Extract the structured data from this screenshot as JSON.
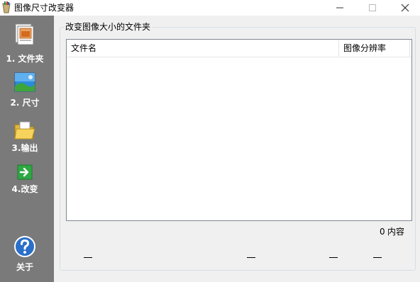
{
  "window": {
    "title": "图像尺寸改变器",
    "minimize_glyph": "—",
    "maximize_glyph": "☐",
    "close_glyph": "✕"
  },
  "sidebar": {
    "items": [
      {
        "label": "1. 文件夹",
        "icon": "folder-documents-icon"
      },
      {
        "label": "2. 尺寸",
        "icon": "landscape-picture-icon"
      },
      {
        "label": "3.输出",
        "icon": "open-folder-icon"
      },
      {
        "label": "4.改变",
        "icon": "green-arrow-icon"
      }
    ],
    "about": {
      "label": "关于",
      "icon": "help-question-icon"
    }
  },
  "group": {
    "title": "改变图像大小的文件夹",
    "columns": [
      "文件名",
      "图像分辨率"
    ],
    "rows": [],
    "count": "0",
    "count_label": "内容"
  },
  "colors": {
    "sidebar_bg": "#7a7a7a",
    "window_bg": "#f0f0f0",
    "help_icon_blue": "#2a6fc9",
    "arrow_green": "#2fa843"
  }
}
